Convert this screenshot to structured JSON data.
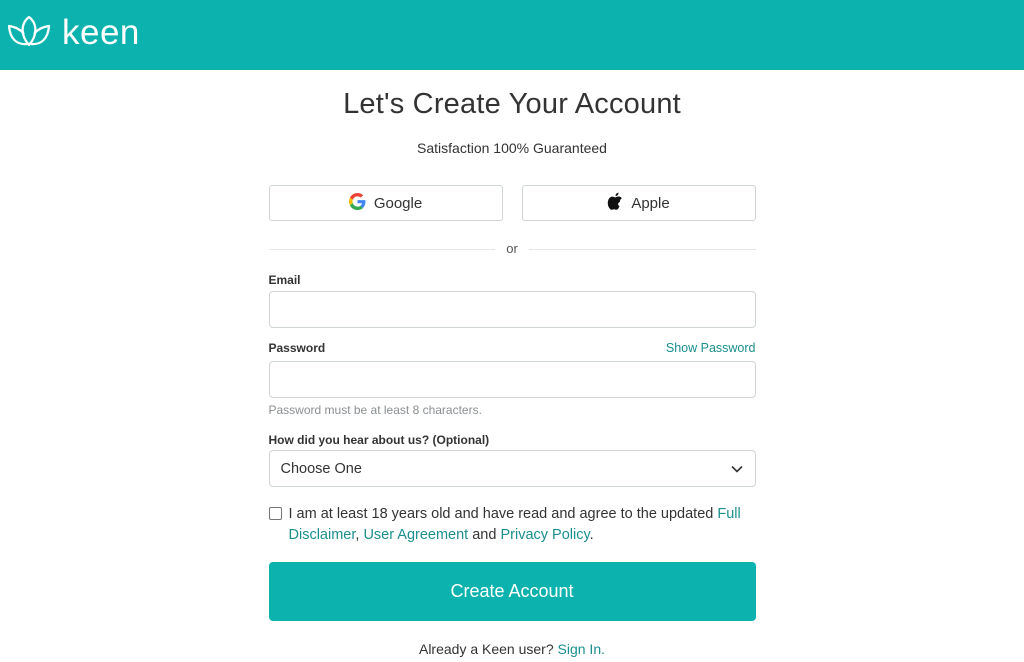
{
  "brand": {
    "name": "keen",
    "color": "#0cb3ae",
    "logo_icon": "lotus-icon"
  },
  "heading": {
    "title": "Let's Create Your Account",
    "subtitle": "Satisfaction 100% Guaranteed"
  },
  "social": {
    "google": {
      "label": "Google",
      "icon": "google-icon"
    },
    "apple": {
      "label": "Apple",
      "icon": "apple-icon"
    }
  },
  "divider": {
    "text": "or"
  },
  "email": {
    "label": "Email",
    "value": "",
    "placeholder": ""
  },
  "password": {
    "label": "Password",
    "value": "",
    "placeholder": "",
    "show_label": "Show Password",
    "hint": "Password must be at least 8 characters."
  },
  "referral": {
    "label": "How did you hear about us? (Optional)",
    "selected": "Choose One",
    "icon": "chevron-down-icon"
  },
  "agreement": {
    "checked": false,
    "text_before": "I am at least 18 years old and have read and agree to the updated ",
    "full_disclaimer": "Full Disclaimer",
    "sep1": ", ",
    "user_agreement": "User Agreement",
    "sep2": " and ",
    "privacy_policy": "Privacy Policy",
    "end": "."
  },
  "submit": {
    "label": "Create Account"
  },
  "signin": {
    "prompt": "Already a Keen user? ",
    "link": "Sign In."
  },
  "colors": {
    "accent": "#0cb3ae",
    "link": "#1a8f8d",
    "border": "#cfd4d6"
  }
}
